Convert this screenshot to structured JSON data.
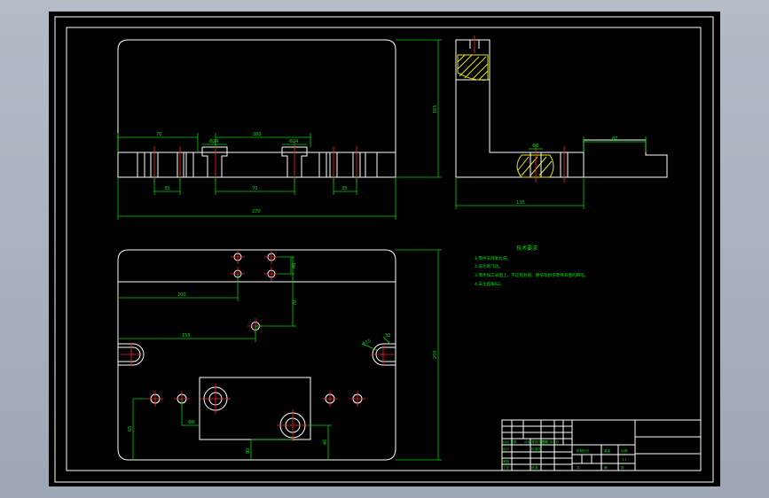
{
  "colors": {
    "background": "#000000",
    "sheet_border": "#ffffff",
    "outline": "#ffffff",
    "dimension": "#00d000",
    "centerline": "#ff2020",
    "hatch": "#e8e800"
  },
  "front_view": {
    "dim_overall_width": "270",
    "dim_left_step": "70",
    "dim_span_top": "200",
    "dim_hole_left": "Φ24",
    "dim_hole_right": "Φ24",
    "dim_bottom_left": "35",
    "dim_bottom_mid": "70",
    "dim_bottom_right": "35",
    "dim_height": "165"
  },
  "side_view": {
    "dim_slot": "Φ8",
    "dim_step_width": "87",
    "dim_base_width": "135"
  },
  "top_view": {
    "dim_hole_spacing_v": "40",
    "dim_pos_x1": "200",
    "dim_pos_y1": "70",
    "dim_pos_x2": "155",
    "dim_slot_radius": "R15",
    "dim_slot_width": "30",
    "dim_height": "200",
    "dim_bottom_left": "65",
    "dim_hole_small": "Φ8",
    "dim_bottom_mid": "80",
    "dim_bottom_right": "40"
  },
  "technical_requirements": {
    "title": "技术要求",
    "lines": [
      "1.零件去除氧化皮。",
      "2.去毛刺飞边。",
      "3.零件加工表面上，不应有划痕、擦伤等损伤零件表面的缺陷。",
      "4.未注圆角R2。"
    ]
  },
  "title_block": {
    "row_label_a": "标记 处数",
    "row_label_b": "分区 更改文件号",
    "row_label_c": "签名 年月日",
    "design": "设计",
    "standardize": "标准化",
    "review": "审核",
    "process": "工艺",
    "approve": "批准",
    "stage_mark": "阶段标记",
    "weight": "重量",
    "scale": "比例",
    "scale_value": "1:1",
    "sheets_total": "共",
    "sheet_no": "第",
    "sheet_label": "张"
  }
}
